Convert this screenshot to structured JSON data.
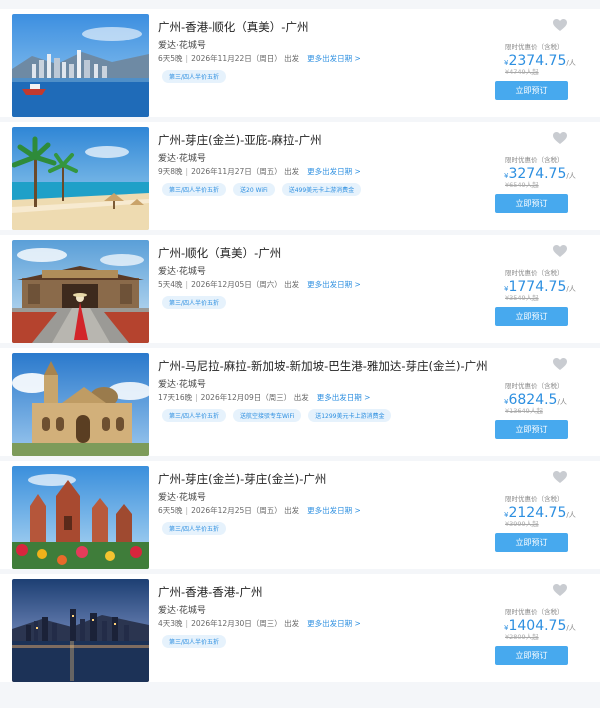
{
  "common": {
    "ship": "爱达·花城号",
    "depart_label": "出发",
    "more_dates": "更多出发日期 >",
    "price_label": "限时优惠价（含税）",
    "currency": "¥",
    "per_person": "/人",
    "book_label": "立即预订",
    "separator": "|"
  },
  "cruises": [
    {
      "title": "广州-香港-顺化（真美）-广州",
      "duration": "6天5晚",
      "date": "2026年11月22日（周日）",
      "price": "2374.75",
      "original": "¥4749人起",
      "tags": [
        "第三/四人半价五折"
      ]
    },
    {
      "title": "广州-芽庄(金兰)-亚庇-麻拉-广州",
      "duration": "9天8晚",
      "date": "2026年11月27日（周五）",
      "price": "3274.75",
      "original": "¥6549人起",
      "tags": [
        "第三/四人半价五折",
        "送20 WiFi",
        "送499美元卡上游消费金"
      ]
    },
    {
      "title": "广州-顺化（真美）-广州",
      "duration": "5天4晚",
      "date": "2026年12月05日（周六）",
      "price": "1774.75",
      "original": "¥3549人起",
      "tags": [
        "第三/四人半价五折"
      ]
    },
    {
      "title": "广州-马尼拉-麻拉-新加坡-新加坡-巴生港-雅加达-芽庄(金兰)-广州",
      "duration": "17天16晚",
      "date": "2026年12月09日（周三）",
      "price": "6824.5",
      "original": "¥13649人起",
      "tags": [
        "第三/四人半价五折",
        "送航空接驳专车WiFi",
        "送1299美元卡上游消费金"
      ]
    },
    {
      "title": "广州-芽庄(金兰)-芽庄(金兰)-广州",
      "duration": "6天5晚",
      "date": "2026年12月25日（周五）",
      "price": "2124.75",
      "original": "¥3999人起",
      "tags": [
        "第三/四人半价五折"
      ]
    },
    {
      "title": "广州-香港-香港-广州",
      "duration": "4天3晚",
      "date": "2026年12月30日（周三）",
      "price": "1404.75",
      "original": "¥2809人起",
      "tags": [
        "第三/四人半价五折"
      ]
    }
  ]
}
